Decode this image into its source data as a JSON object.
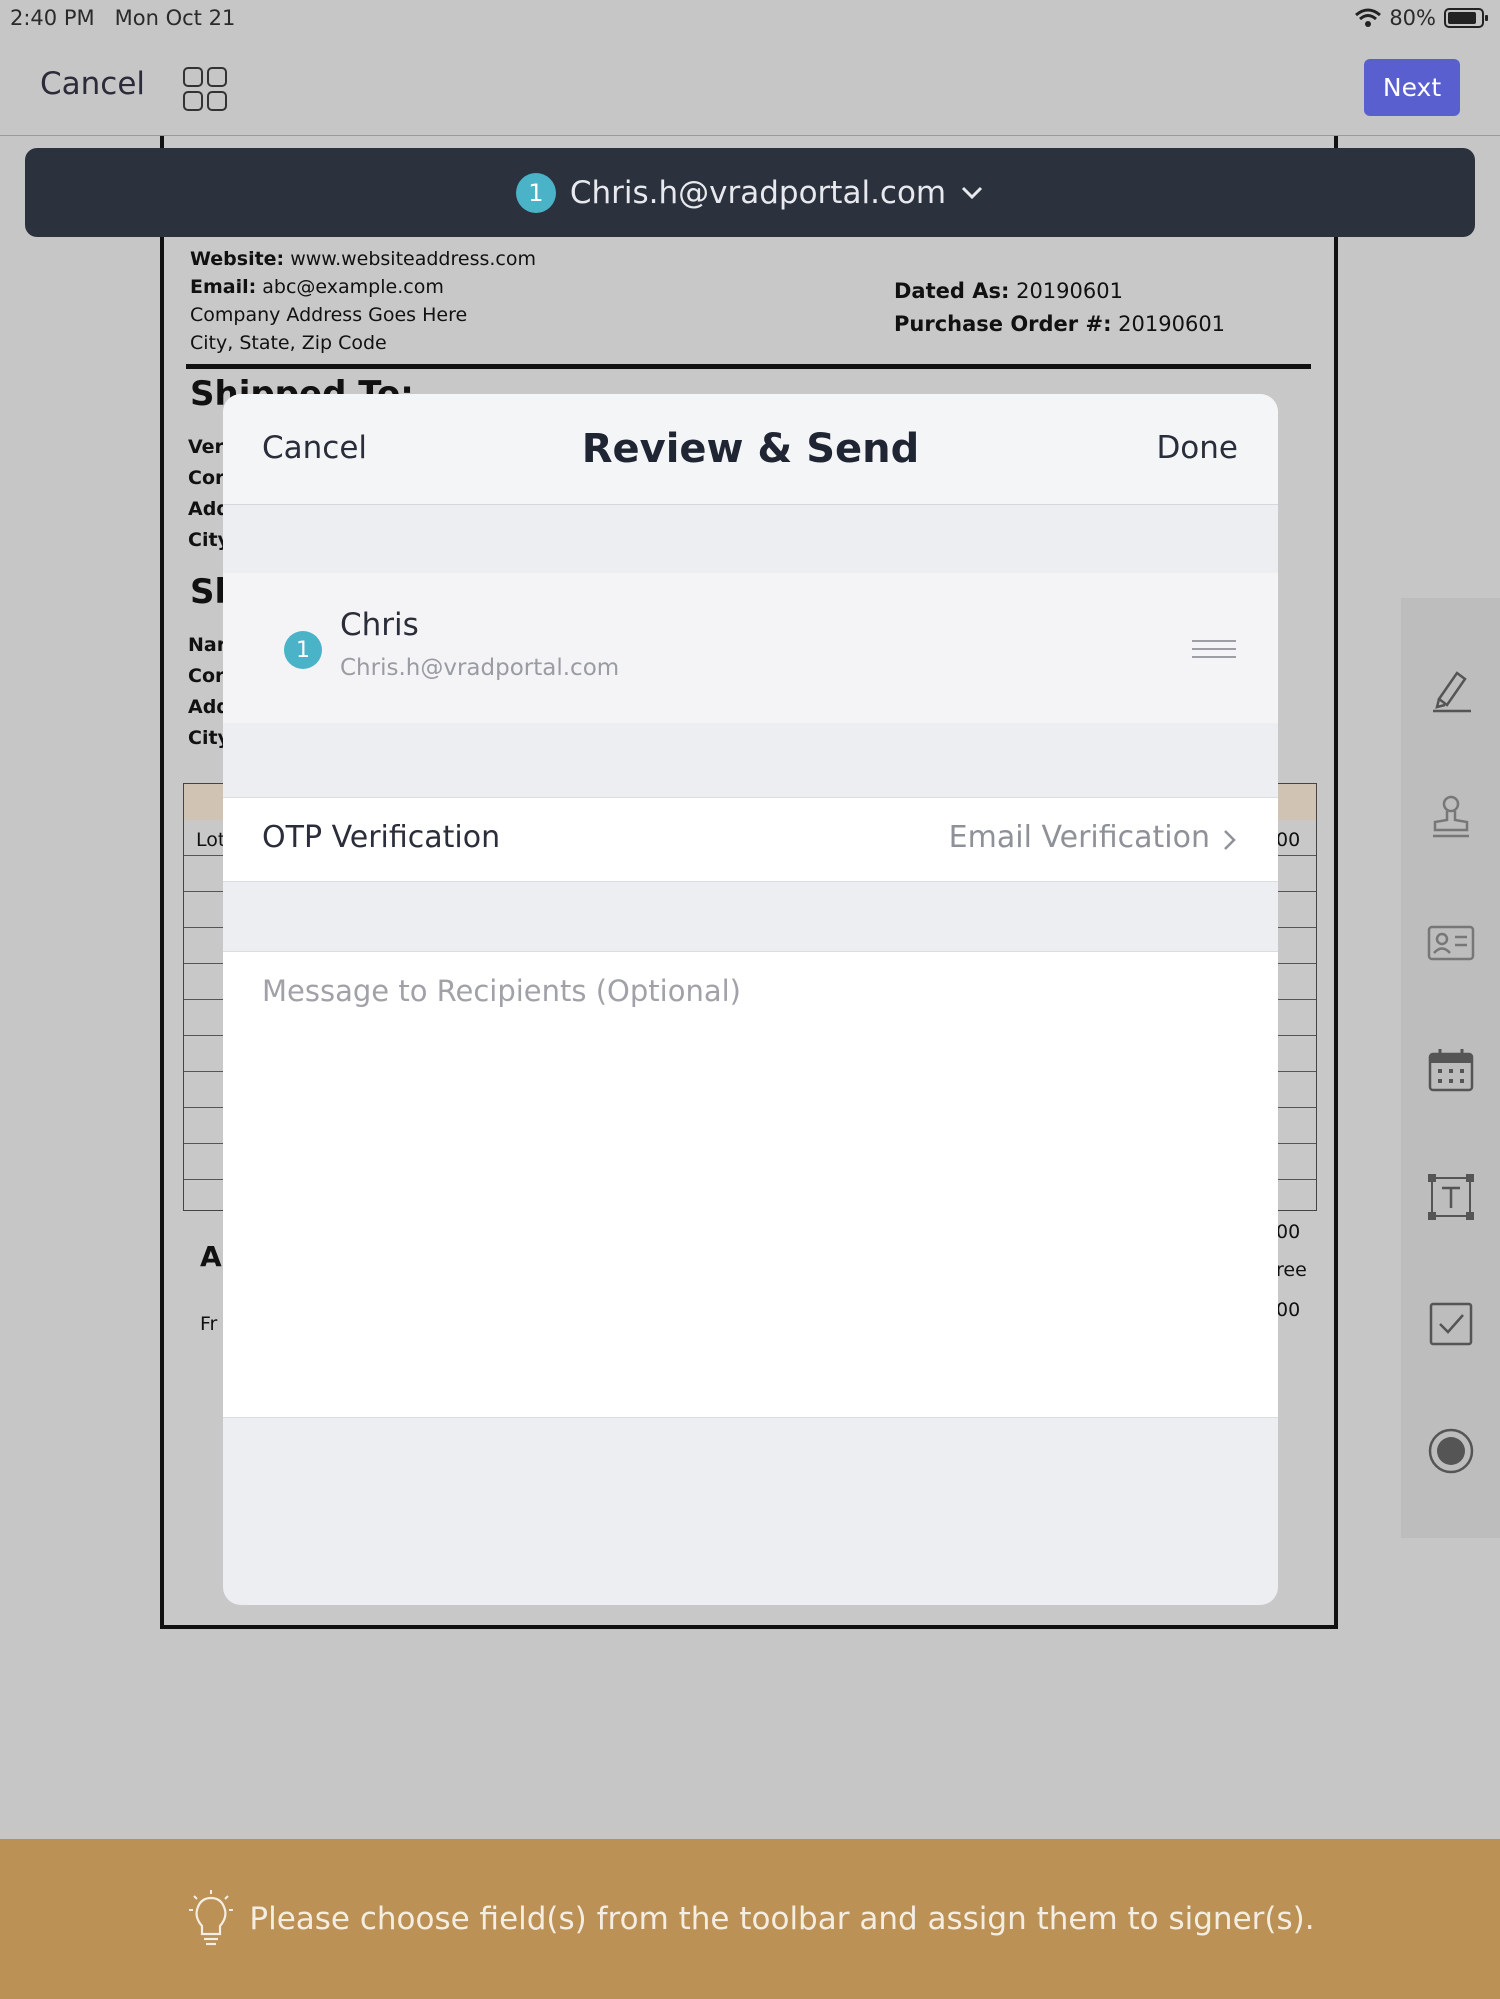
{
  "status_bar": {
    "time": "2:40 PM",
    "date": "Mon Oct 21",
    "battery": "80%",
    "icons": [
      "wifi-icon",
      "battery-icon"
    ]
  },
  "nav": {
    "cancel_label": "Cancel",
    "next_label": "Next",
    "grid_icon": "grid-icon"
  },
  "signer_bar": {
    "badge": "1",
    "email": "Chris.h@vradportal.com",
    "icon": "chevron-down-icon"
  },
  "document": {
    "website_label": "Website:",
    "website": "www.websiteaddress.com",
    "email_label": "Email:",
    "email": "abc@example.com",
    "address": "Company Address Goes Here",
    "city": "City, State, Zip Code",
    "dated_label": "Dated As:",
    "dated": "20190601",
    "po_label": "Purchase Order #:",
    "po": "20190601",
    "shipped_to": "Shipped To:",
    "row_labels": [
      "Ver",
      "Cor",
      "Add",
      "City"
    ],
    "sh": "Sh",
    "row_labels2": [
      "Nar",
      "Cor",
      "Add",
      "City"
    ],
    "lot": "Lot",
    "a": "A",
    "fr": "Fr",
    "cell_00": "00",
    "cell_00b": "00",
    "cell_ree": "ree",
    "cell_00c": "00"
  },
  "toolbar": {
    "tools": [
      "signature-icon",
      "stamp-icon",
      "id-card-icon",
      "calendar-icon",
      "text-field-icon",
      "checkbox-icon",
      "radio-icon"
    ]
  },
  "modal": {
    "cancel_label": "Cancel",
    "title": "Review & Send",
    "done_label": "Done",
    "recipient": {
      "badge": "1",
      "name": "Chris",
      "email": "Chris.h@vradportal.com"
    },
    "otp": {
      "label": "OTP Verification",
      "value": "Email Verification"
    },
    "message_placeholder": "Message to Recipients (Optional)"
  },
  "tip": {
    "text": "Please choose field(s) from the toolbar and assign them to signer(s).",
    "icon": "lightbulb-icon"
  },
  "colors": {
    "accent": "#5a5fd0",
    "signer_bar": "#2b313d",
    "badge": "#4ab3c8",
    "tip_bar": "#bb9156"
  }
}
